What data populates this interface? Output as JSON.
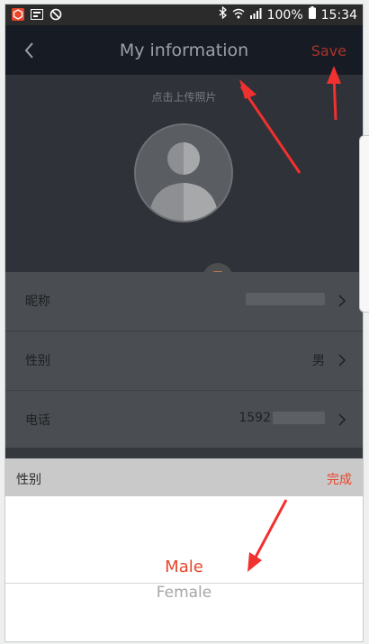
{
  "status_bar": {
    "battery": "100%",
    "time": "15:34"
  },
  "nav": {
    "title": "My information",
    "save_label": "Save"
  },
  "header": {
    "upload_hint": "点击上传照片"
  },
  "list": [
    {
      "label": "昵称",
      "value": ""
    },
    {
      "label": "性别",
      "value": "男"
    },
    {
      "label": "电话",
      "value": "1592"
    }
  ],
  "picker": {
    "title": "性别",
    "done_label": "完成",
    "options": [
      "Male",
      "Female"
    ],
    "selected": "Male"
  },
  "colors": {
    "accent": "#e8452b",
    "navbar": "#171b24",
    "header": "#2f3238",
    "arrow": "#f0312f"
  }
}
